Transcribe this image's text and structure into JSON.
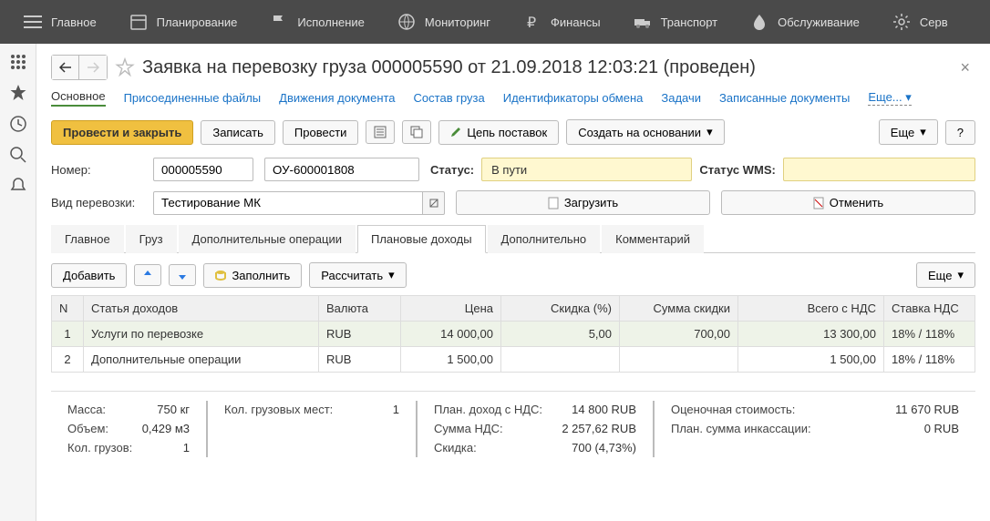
{
  "topnav": [
    {
      "label": "Главное"
    },
    {
      "label": "Планирование"
    },
    {
      "label": "Исполнение"
    },
    {
      "label": "Мониторинг"
    },
    {
      "label": "Финансы"
    },
    {
      "label": "Транспорт"
    },
    {
      "label": "Обслуживание"
    },
    {
      "label": "Серв"
    }
  ],
  "page_title": "Заявка на перевозку груза 000005590 от 21.09.2018 12:03:21 (проведен)",
  "subnav": {
    "main": "Основное",
    "files": "Присоединенные файлы",
    "moves": "Движения документа",
    "cargo": "Состав груза",
    "ids": "Идентификаторы обмена",
    "tasks": "Задачи",
    "docs": "Записанные документы",
    "more": "Еще..."
  },
  "toolbar": {
    "post_close": "Провести и закрыть",
    "save": "Записать",
    "post": "Провести",
    "supply": "Цепь поставок",
    "create": "Создать на основании",
    "more": "Еще",
    "help": "?"
  },
  "form": {
    "number_label": "Номер:",
    "number": "000005590",
    "ext_number": "ОУ-600001808",
    "status_label": "Статус:",
    "status": "В пути",
    "wms_label": "Статус WMS:",
    "type_label": "Вид перевозки:",
    "type": "Тестирование МК",
    "load_btn": "Загрузить",
    "cancel_btn": "Отменить"
  },
  "tabs": [
    {
      "label": "Главное"
    },
    {
      "label": "Груз"
    },
    {
      "label": "Дополнительные операции"
    },
    {
      "label": "Плановые доходы",
      "active": true
    },
    {
      "label": "Дополнительно"
    },
    {
      "label": "Комментарий"
    }
  ],
  "table_toolbar": {
    "add": "Добавить",
    "fill": "Заполнить",
    "calc": "Рассчитать",
    "more": "Еще"
  },
  "grid": {
    "columns": [
      "N",
      "Статья доходов",
      "Валюта",
      "Цена",
      "Скидка (%)",
      "Сумма скидки",
      "Всего с НДС",
      "Ставка НДС"
    ],
    "rows": [
      {
        "n": "1",
        "item": "Услуги по перевозке",
        "cur": "RUB",
        "price": "14 000,00",
        "disc_pct": "5,00",
        "disc_sum": "700,00",
        "total": "13 300,00",
        "vat": "18% / 118%",
        "selected": true
      },
      {
        "n": "2",
        "item": "Дополнительные операции",
        "cur": "RUB",
        "price": "1 500,00",
        "disc_pct": "",
        "disc_sum": "",
        "total": "1 500,00",
        "vat": "18% / 118%"
      }
    ]
  },
  "summary": {
    "mass_l": "Масса:",
    "mass_v": "750 кг",
    "vol_l": "Объем:",
    "vol_v": "0,429 м3",
    "cnt_l": "Кол. грузов:",
    "cnt_v": "1",
    "places_l": "Кол. грузовых мест:",
    "places_v": "1",
    "plan_l": "План. доход с НДС:",
    "plan_v": "14 800 RUB",
    "vatsum_l": "Сумма НДС:",
    "vatsum_v": "2 257,62 RUB",
    "disc_l": "Скидка:",
    "disc_v": "700 (4,73%)",
    "est_l": "Оценочная стоимость:",
    "est_v": "11 670 RUB",
    "cash_l": "План. сумма инкассации:",
    "cash_v": "0 RUB"
  }
}
